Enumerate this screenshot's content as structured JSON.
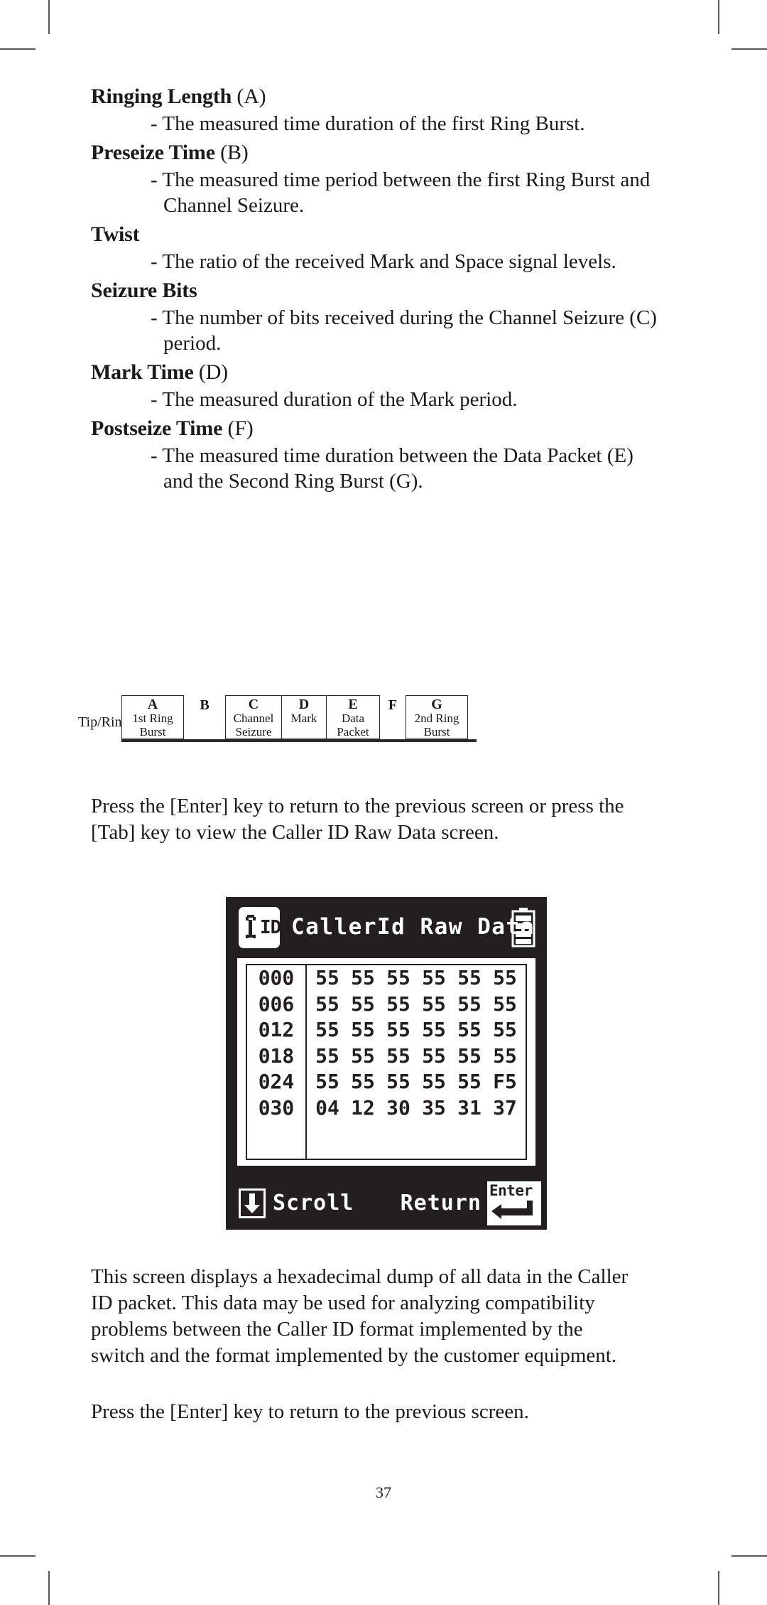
{
  "terms": [
    {
      "name": "Ringing Length",
      "letter": "(A)",
      "definition": "- The measured time duration of the first Ring Burst."
    },
    {
      "name": "Preseize Time",
      "letter": "(B)",
      "definition": "- The measured time period between the first Ring Burst and Channel Seizure."
    },
    {
      "name": "Twist",
      "letter": "",
      "definition": "- The ratio of the received Mark and Space signal levels."
    },
    {
      "name": "Seizure Bits",
      "letter": "",
      "definition": "- The number of bits received during the Channel Seizure (C) period."
    },
    {
      "name": "Mark Time",
      "letter": "(D)",
      "definition": "- The measured duration of the Mark period."
    },
    {
      "name": "Postseize Time",
      "letter": "(F)",
      "definition": "- The measured time duration between the Data Packet (E) and the Second Ring Burst (G)."
    }
  ],
  "diagram": {
    "signal_label": "Tip/Ring",
    "segments": [
      {
        "letter": "A",
        "line1": "1st Ring",
        "line2": "Burst",
        "boxed": true
      },
      {
        "letter": "B",
        "line1": "",
        "line2": "",
        "boxed": false
      },
      {
        "letter": "C",
        "line1": "Channel",
        "line2": "Seizure",
        "boxed": true
      },
      {
        "letter": "D",
        "line1": "Mark",
        "line2": "",
        "boxed": true
      },
      {
        "letter": "E",
        "line1": "Data",
        "line2": "Packet",
        "boxed": true
      },
      {
        "letter": "F",
        "line1": "",
        "line2": "",
        "boxed": false
      },
      {
        "letter": "G",
        "line1": "2nd Ring",
        "line2": "Burst",
        "boxed": true
      }
    ]
  },
  "paragraphs": {
    "p1": "Press the [Enter] key to return to the previous screen or press the [Tab] key to view the Caller ID Raw Data screen.",
    "p2": "This screen displays a hexadecimal dump of all data in the Caller ID packet. This data may be used for analyzing compatibility problems between the Caller ID format implemented by the switch and the format implemented by the customer equipment.",
    "p3": "Press the [Enter] key to return to the previous screen."
  },
  "lcd": {
    "title": "CallerId Raw Data",
    "icon_label": "ID",
    "icon_name": "caller-id-icon",
    "battery_icon": "battery-full-icon",
    "rows": [
      {
        "addr": "000",
        "bytes": [
          "55",
          "55",
          "55",
          "55",
          "55",
          "55"
        ]
      },
      {
        "addr": "006",
        "bytes": [
          "55",
          "55",
          "55",
          "55",
          "55",
          "55"
        ]
      },
      {
        "addr": "012",
        "bytes": [
          "55",
          "55",
          "55",
          "55",
          "55",
          "55"
        ]
      },
      {
        "addr": "018",
        "bytes": [
          "55",
          "55",
          "55",
          "55",
          "55",
          "55"
        ]
      },
      {
        "addr": "024",
        "bytes": [
          "55",
          "55",
          "55",
          "55",
          "55",
          "F5"
        ]
      },
      {
        "addr": "030",
        "bytes": [
          "04",
          "12",
          "30",
          "35",
          "31",
          "37"
        ]
      }
    ],
    "footer": {
      "scroll_label": "Scroll",
      "scroll_icon": "arrow-down-icon",
      "return_label": "Return",
      "enter_key_label": "Enter",
      "enter_key_icon": "enter-return-arrow-icon"
    },
    "colors": {
      "bezel": "#231f20",
      "screen": "#ffffff"
    }
  },
  "page_number": "37"
}
